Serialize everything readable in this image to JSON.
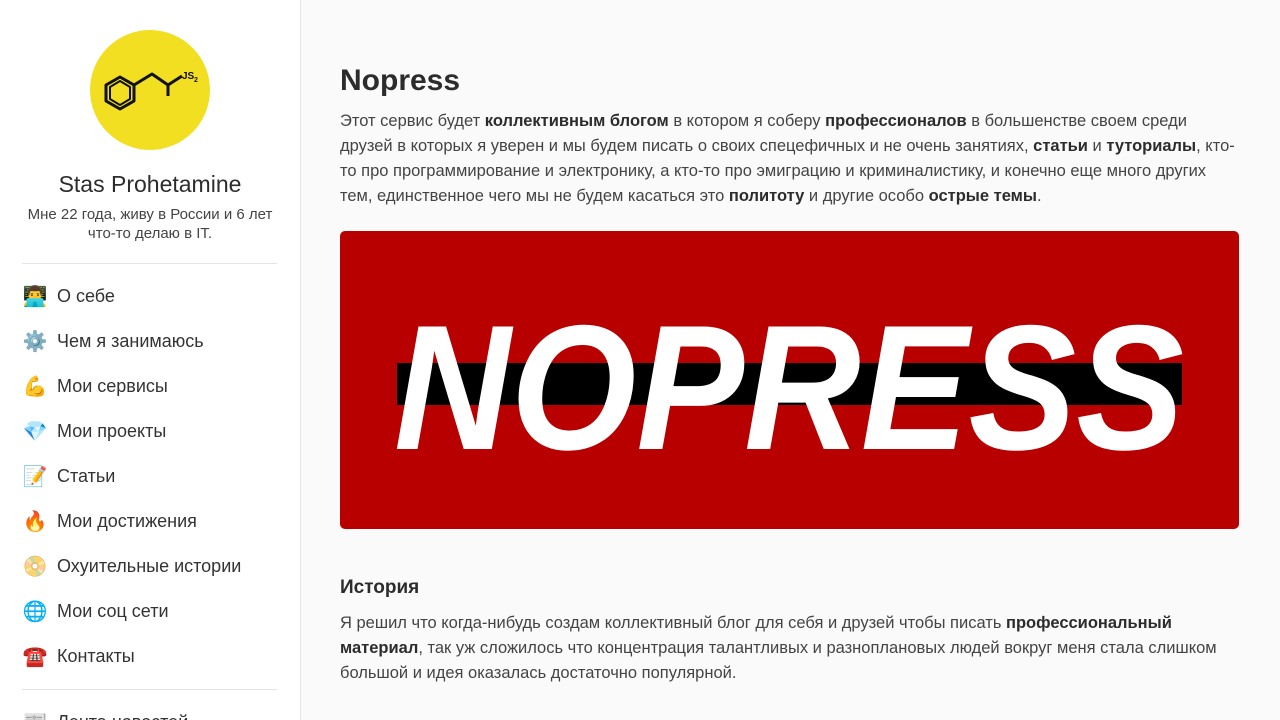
{
  "profile": {
    "name": "Stas Prohetamine",
    "bio": "Мне 22 года, живу в России и 6 лет что-то делаю в IT.",
    "avatar_badge": "JS",
    "avatar_badge_sub": "2",
    "avatar_color": "#f3df22"
  },
  "nav": {
    "items": [
      {
        "icon": "👨‍💻",
        "icon_name": "technologist-icon",
        "label": "О себе"
      },
      {
        "icon": "⚙️",
        "icon_name": "gear-icon",
        "label": "Чем я занимаюсь"
      },
      {
        "icon": "💪",
        "icon_name": "flexed-biceps-icon",
        "label": "Мои сервисы"
      },
      {
        "icon": "💎",
        "icon_name": "gem-icon",
        "label": "Мои проекты"
      },
      {
        "icon": "📝",
        "icon_name": "memo-icon",
        "label": "Статьи"
      },
      {
        "icon": "🔥",
        "icon_name": "fire-icon",
        "label": "Мои достижения"
      },
      {
        "icon": "📀",
        "icon_name": "dvd-icon",
        "label": "Охуительные истории"
      },
      {
        "icon": "🌐",
        "icon_name": "globe-icon",
        "label": "Мои соц сети"
      },
      {
        "icon": "☎️",
        "icon_name": "telephone-icon",
        "label": "Контакты"
      }
    ],
    "extra": {
      "icon": "📰",
      "icon_name": "newspaper-icon",
      "label": "Лента новостей"
    }
  },
  "main": {
    "title": "Nopress",
    "intro": {
      "t1": "Этот сервис будет ",
      "b1": "коллективным блогом",
      "t2": " в котором я соберу ",
      "b2": "профессионалов",
      "t3": " в большенстве своем среди друзей в которых я уверен и мы будем писать о своих спецефичных и не очень занятиях, ",
      "b3": "статьи",
      "t4": " и ",
      "b4": "туториалы",
      "t5": ", кто-то про программирование и электронику, а кто-то про эмиграцию и криминалистику, и конечно еще много других тем, единственное чего мы не будем касаться это ",
      "b5": "политоту",
      "t6": " и другие особо ",
      "b6": "острые темы",
      "t7": "."
    },
    "banner": {
      "text": "NOPRESS",
      "bg_color": "#b80000",
      "stripe_color": "#000000",
      "text_color": "#ffffff"
    },
    "history": {
      "title": "История",
      "t1": "Я решил что когда-нибудь создам коллективный блог для себя и друзей чтобы писать ",
      "b1": "профессиональный материал",
      "t2": ", так уж сложилось что концентрация талантливых и разноплановых людей вокруг меня стала слишком большой и идея оказалась достаточно популярной."
    }
  }
}
